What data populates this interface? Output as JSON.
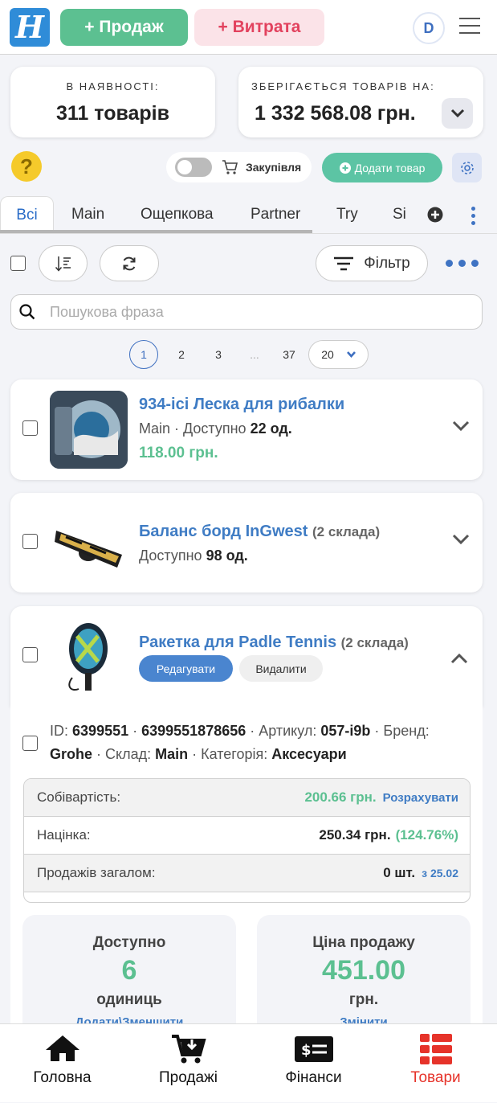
{
  "header": {
    "logo_letter": "H",
    "sale_button": "+ Продаж",
    "expense_button": "+ Витрата",
    "avatar_initial": "D"
  },
  "stats": {
    "in_stock_label": "В НАЯВНОСТІ:",
    "in_stock_value": "311 товарів",
    "stored_label": "ЗБЕРІГАЄТЬСЯ ТОВАРІВ НА:",
    "stored_value": "1 332 568.08 грн."
  },
  "toolbar": {
    "help": "?",
    "purchase_toggle_label": "Закупівля",
    "purchase_toggle_on": false,
    "add_product": "Додати товар"
  },
  "tabs": [
    "Всі",
    "Main",
    "Ощепкова",
    "Partner",
    "Try",
    "Si"
  ],
  "actions": {
    "filter": "Фільтр"
  },
  "search": {
    "placeholder": "Пошукова фраза",
    "value": ""
  },
  "pagination": {
    "pages": [
      "1",
      "2",
      "3",
      "...",
      "37"
    ],
    "current": "1",
    "per_page": "20"
  },
  "products": [
    {
      "title": "934-ісі Леска для рибалки",
      "warehouse": "Main",
      "available_label": "Доступно",
      "available": "22 од.",
      "price": "118.00 грн."
    },
    {
      "title": "Баланс борд InGwest",
      "stores": "(2 склада)",
      "available_label": "Доступно",
      "available": "98 од."
    },
    {
      "title": "Ракетка для Padle Tennis",
      "stores": "(2 склада)",
      "edit": "Редагувати",
      "delete": "Видалити",
      "details": {
        "id_label": "ID:",
        "id": "6399551",
        "barcode": "6399551878656",
        "sku_label": "Артикул:",
        "sku": "057-i9b",
        "brand_label": "Бренд:",
        "brand": "Grohe",
        "warehouse_label": "Склад:",
        "warehouse": "Main",
        "category_label": "Категорія:",
        "category": "Аксесуари",
        "cost_label": "Собівартість:",
        "cost": "200.66 грн.",
        "calculate": "Розрахувати",
        "markup_label": "Націнка:",
        "markup": "250.34 грн.",
        "markup_pct": "(124.76%)",
        "sales_label": "Продажів загалом:",
        "sales": "0 шт.",
        "sales_since": "з 25.02",
        "avail_title": "Доступно",
        "avail_value": "6",
        "avail_unit": "одиниць",
        "avail_link": "Додати\\Зменшити",
        "price_title": "Ціна продажу",
        "price_value": "451.00",
        "price_unit": "грн.",
        "price_link": "Змінити"
      }
    }
  ],
  "bottom_nav": [
    "Головна",
    "Продажі",
    "Фінанси",
    "Товари"
  ],
  "colors": {
    "brand_blue": "#2f8cd8",
    "green": "#5cc091",
    "red": "#e2425e",
    "active_nav": "#e6332a"
  }
}
